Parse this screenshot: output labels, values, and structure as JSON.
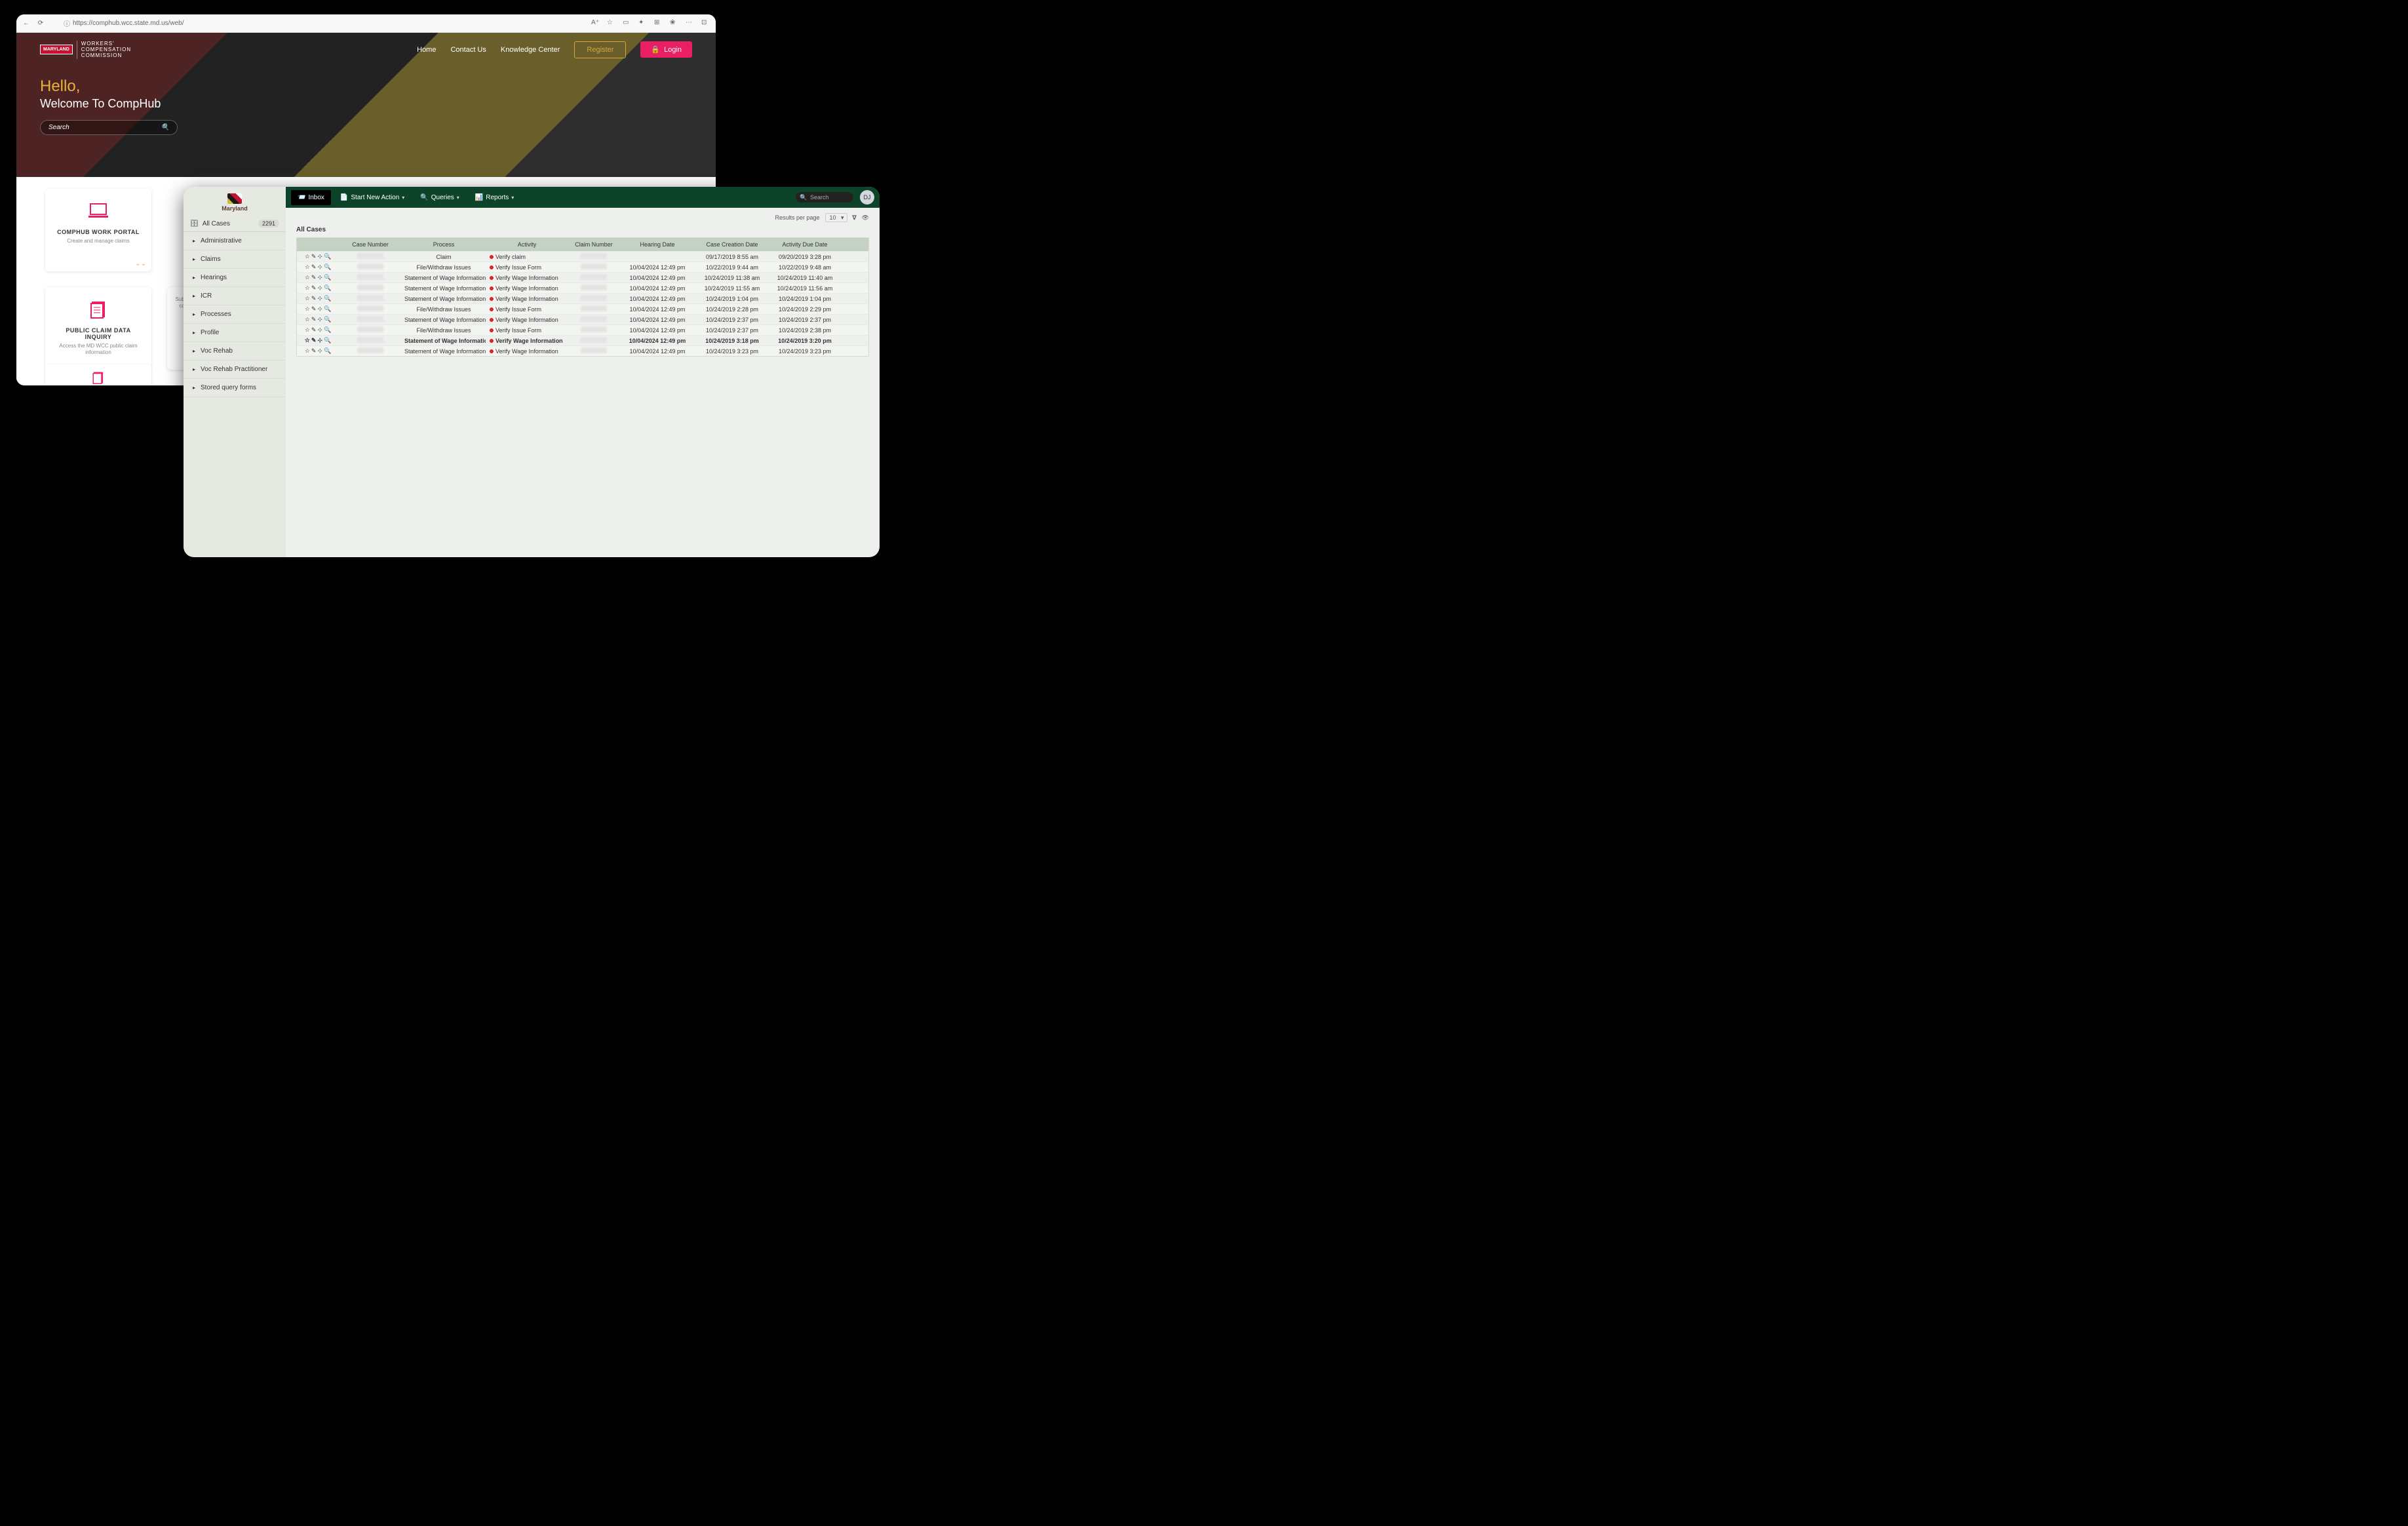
{
  "browser": {
    "url": "https://comphub.wcc.state.md.us/web/",
    "logo_sub": "MARYLAND",
    "wcc_lines": "WORKERS'\nCOMPENSATION\nCOMMISSION",
    "nav": {
      "home": "Home",
      "contact": "Contact Us",
      "kc": "Knowledge Center",
      "register": "Register",
      "login": "Login"
    },
    "hello": "Hello,",
    "welcome": "Welcome To CompHub",
    "search_ph": "Search",
    "cards": [
      {
        "title": "COMPHUB WORK PORTAL",
        "desc": "Create and manage claims"
      },
      {
        "title": "",
        "desc": "Submit\ncon"
      },
      {
        "title": "PUBLIC CLAIM DATA INQUIRY",
        "desc": "Access the MD WCC public claim information"
      }
    ]
  },
  "app": {
    "sidebar": {
      "logo": "Maryland",
      "allcases": "All Cases",
      "badge": "2291",
      "items": [
        "Administrative",
        "Claims",
        "Hearings",
        "ICR",
        "Processes",
        "Profile",
        "Voc Rehab",
        "Voc Rehab Practitioner",
        "Stored query forms"
      ]
    },
    "topbar": {
      "inbox": "Inbox",
      "start": "Start New Action",
      "queries": "Queries",
      "reports": "Reports",
      "search_ph": "Search",
      "avatar": "DJ"
    },
    "controls": {
      "rpp_label": "Results per page",
      "rpp_value": "10"
    },
    "title": "All Cases",
    "columns": {
      "case": "Case Number",
      "process": "Process",
      "activity": "Activity",
      "claim": "Claim Number",
      "hearing": "Hearing Date",
      "creation": "Case Creation Date",
      "due": "Activity Due Date"
    },
    "rows": [
      {
        "process": "Claim",
        "activity": "Verify claim",
        "hearing": "",
        "creation": "09/17/2019 8:55 am",
        "due": "09/20/2019 3:28 pm",
        "bold": false
      },
      {
        "process": "File/Withdraw Issues",
        "activity": "Verify Issue Form",
        "hearing": "10/04/2024 12:49 pm",
        "creation": "10/22/2019 9:44 am",
        "due": "10/22/2019 9:48 am",
        "bold": false
      },
      {
        "process": "Statement of Wage Information",
        "activity": "Verify Wage Information",
        "hearing": "10/04/2024 12:49 pm",
        "creation": "10/24/2019 11:38 am",
        "due": "10/24/2019 11:40 am",
        "bold": false
      },
      {
        "process": "Statement of Wage Information",
        "activity": "Verify Wage Information",
        "hearing": "10/04/2024 12:49 pm",
        "creation": "10/24/2019 11:55 am",
        "due": "10/24/2019 11:56 am",
        "bold": false
      },
      {
        "process": "Statement of Wage Information",
        "activity": "Verify Wage Information",
        "hearing": "10/04/2024 12:49 pm",
        "creation": "10/24/2019 1:04 pm",
        "due": "10/24/2019 1:04 pm",
        "bold": false
      },
      {
        "process": "File/Withdraw Issues",
        "activity": "Verify Issue Form",
        "hearing": "10/04/2024 12:49 pm",
        "creation": "10/24/2019 2:28 pm",
        "due": "10/24/2019 2:29 pm",
        "bold": false
      },
      {
        "process": "Statement of Wage Information",
        "activity": "Verify Wage Information",
        "hearing": "10/04/2024 12:49 pm",
        "creation": "10/24/2019 2:37 pm",
        "due": "10/24/2019 2:37 pm",
        "bold": false
      },
      {
        "process": "File/Withdraw Issues",
        "activity": "Verify Issue Form",
        "hearing": "10/04/2024 12:49 pm",
        "creation": "10/24/2019 2:37 pm",
        "due": "10/24/2019 2:38 pm",
        "bold": false
      },
      {
        "process": "Statement of Wage Information",
        "activity": "Verify Wage Information",
        "hearing": "10/04/2024 12:49 pm",
        "creation": "10/24/2019 3:18 pm",
        "due": "10/24/2019 3:20 pm",
        "bold": true
      },
      {
        "process": "Statement of Wage Information",
        "activity": "Verify Wage Information",
        "hearing": "10/04/2024 12:49 pm",
        "creation": "10/24/2019 3:23 pm",
        "due": "10/24/2019 3:23 pm",
        "bold": false
      }
    ]
  }
}
